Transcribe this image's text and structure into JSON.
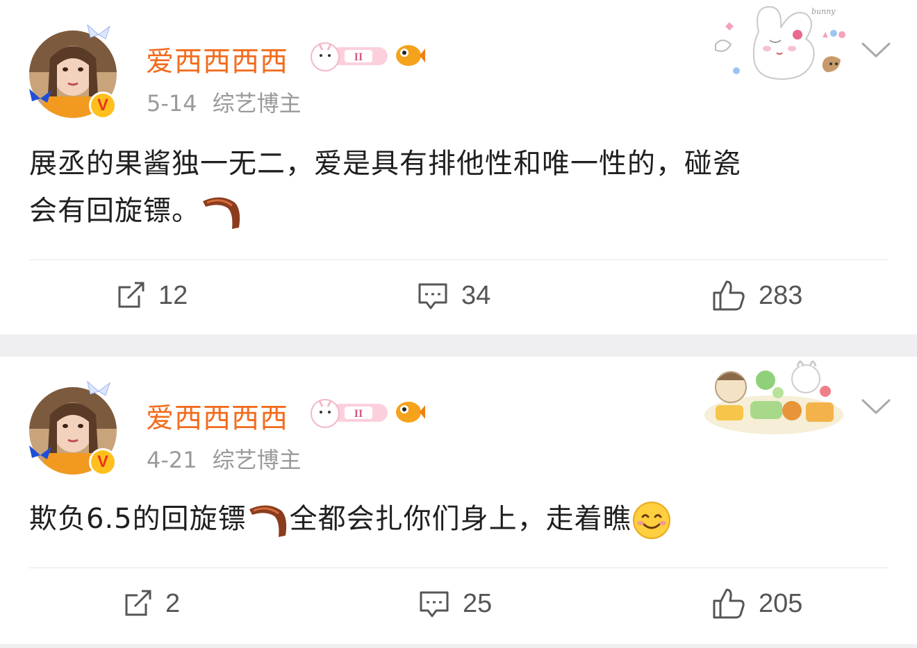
{
  "posts": [
    {
      "username": "爱西西西西",
      "date": "5-14",
      "role": "综艺博主",
      "text_line1": "展丞的果酱独一无二，爱是具有排他性和唯一性的，碰瓷",
      "text_line2": "会有回旋镖。",
      "repost_count": "12",
      "comment_count": "34",
      "like_count": "283",
      "decor_label": "bunny"
    },
    {
      "username": "爱西西西西",
      "date": "4-21",
      "role": "综艺博主",
      "text_part1": "欺负6.5的回旋镖",
      "text_part2": "全都会扎你们身上，走着瞧",
      "repost_count": "2",
      "comment_count": "25",
      "like_count": "205"
    }
  ],
  "badges": {
    "gemini": "II",
    "verified": "V"
  },
  "colors": {
    "username": "#f26b1d",
    "meta": "#9a9a9a",
    "separator": "#efeff1",
    "verified": "#ffc01e"
  }
}
